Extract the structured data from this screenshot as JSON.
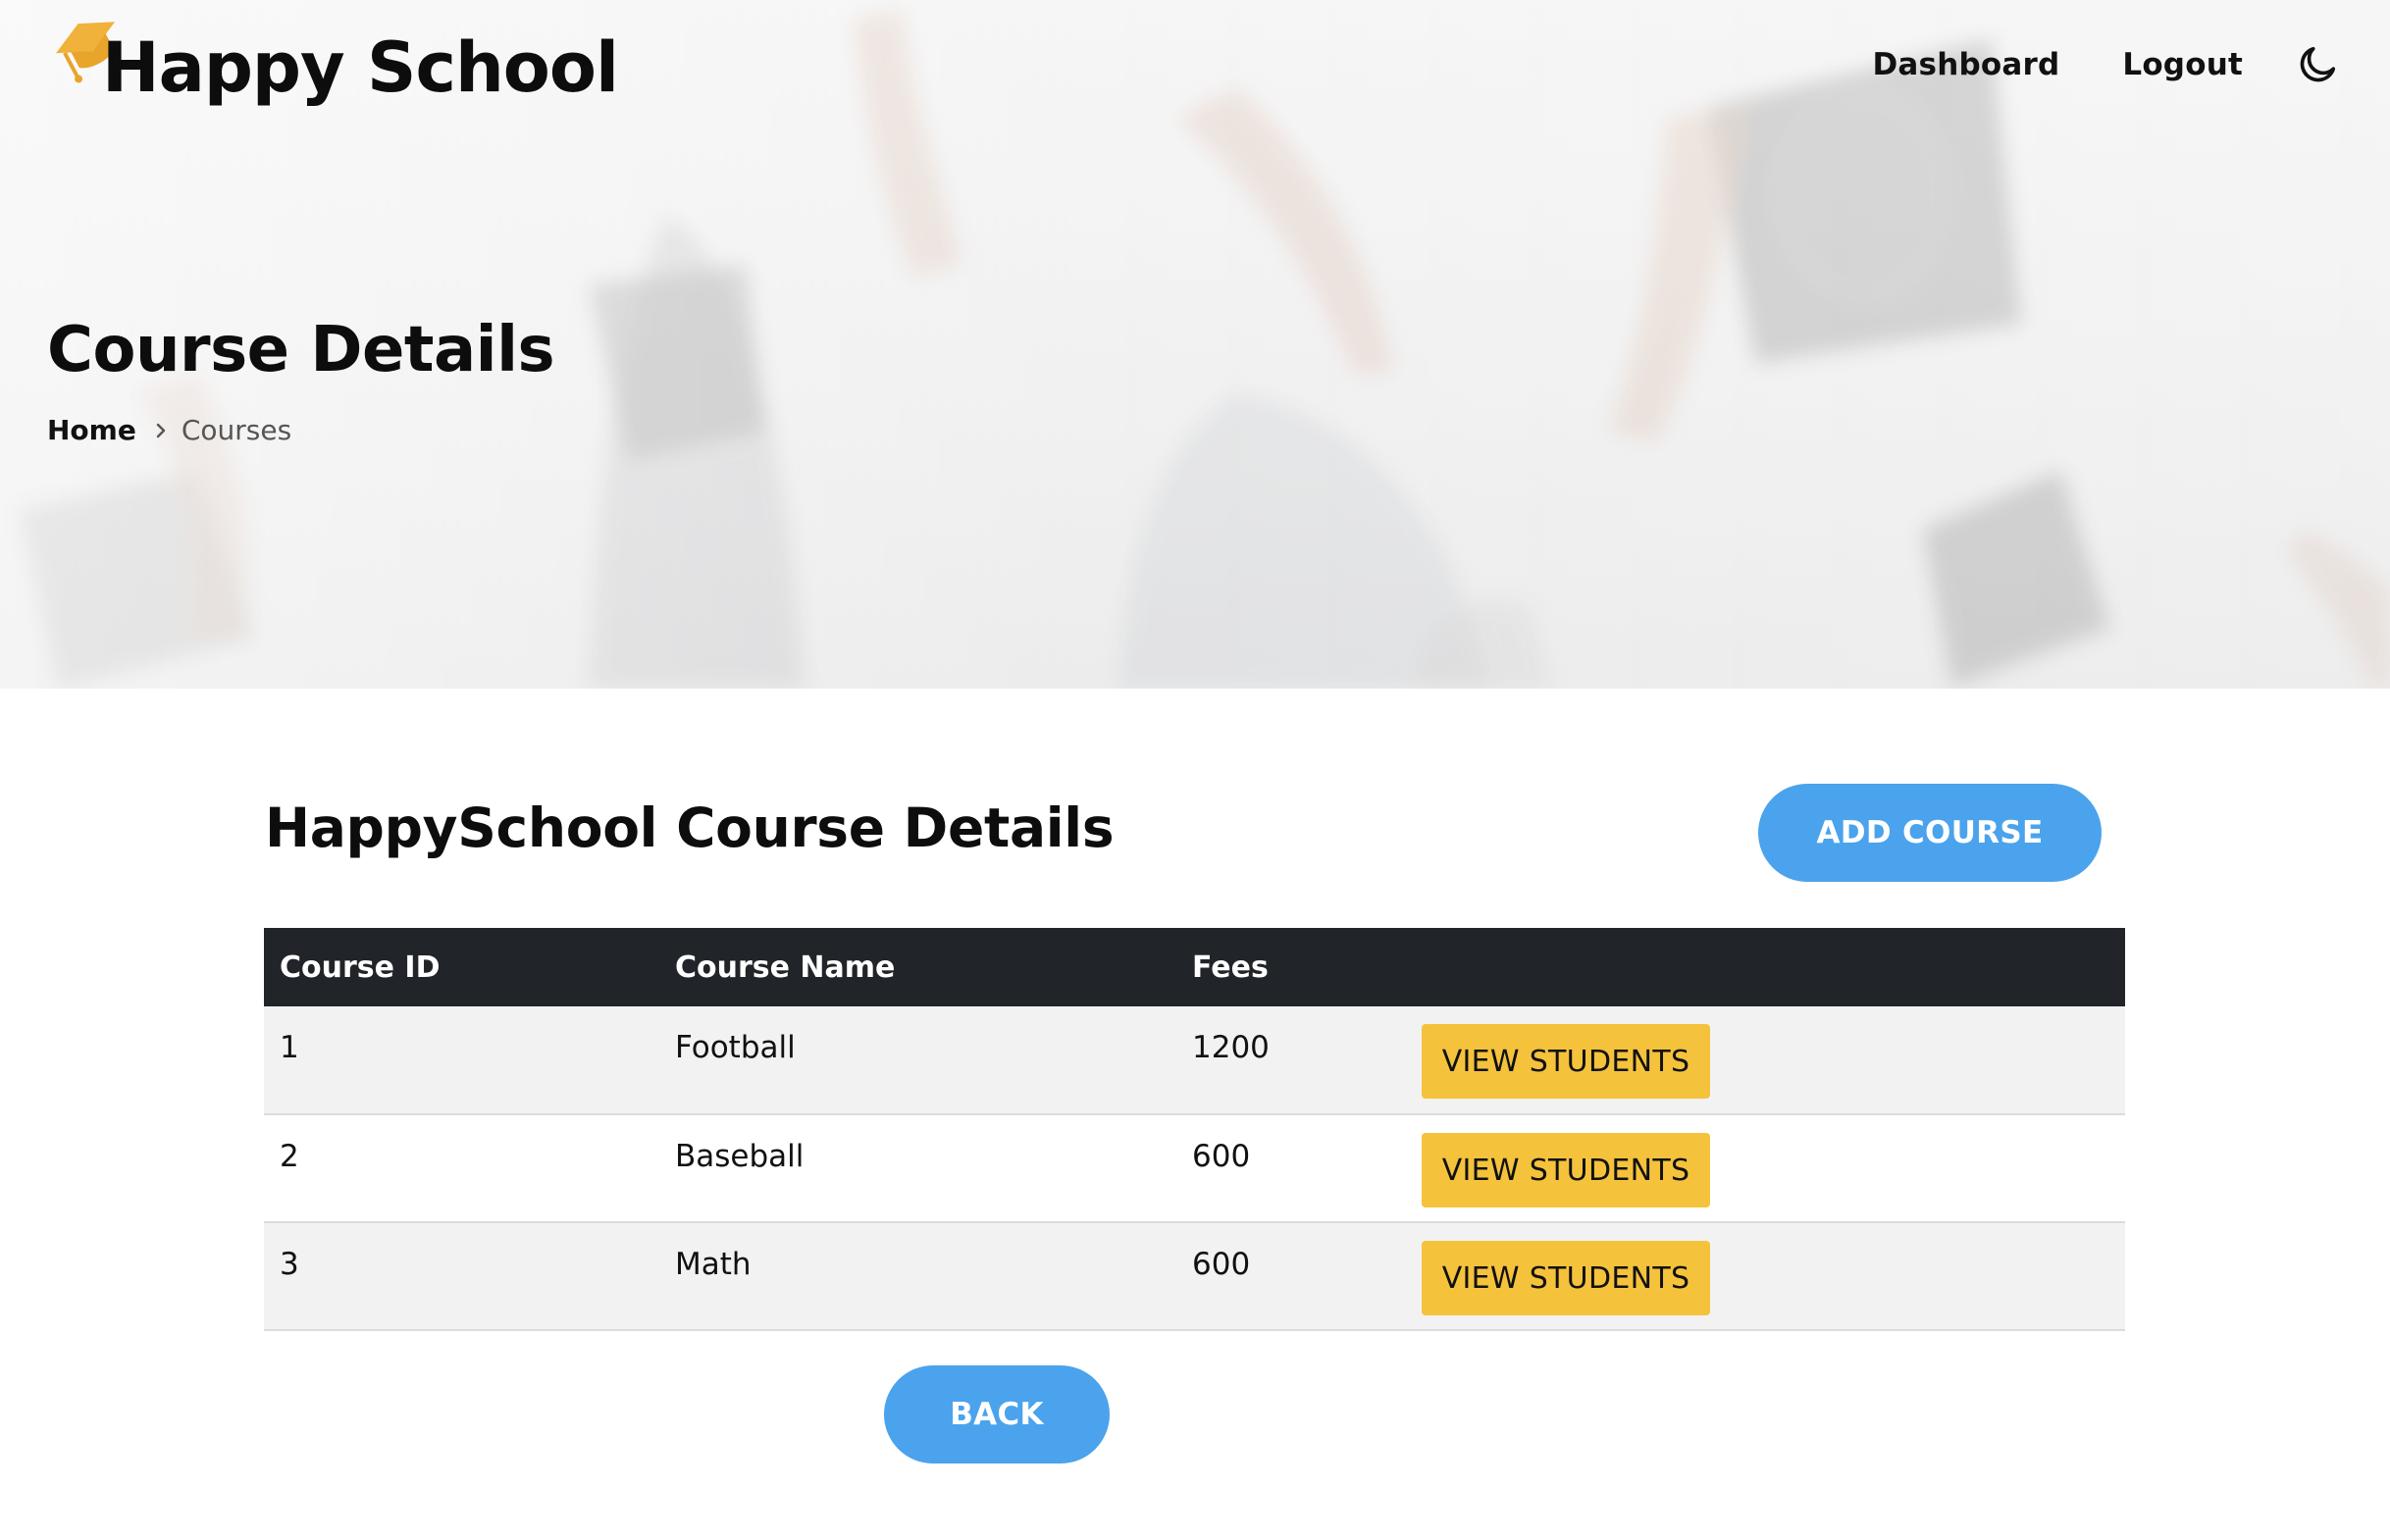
{
  "header": {
    "brand_name": "Happy School",
    "brand_icon": "graduation-cap-icon",
    "brand_color": "#f0b23a",
    "nav": [
      {
        "label": "Dashboard"
      },
      {
        "label": "Logout"
      }
    ],
    "theme_toggle_icon": "moon-icon"
  },
  "hero": {
    "title": "Course Details",
    "breadcrumb": {
      "home": "Home",
      "separator_icon": "chevron-right-icon",
      "current": "Courses"
    }
  },
  "main": {
    "section_title": "HappySchool Course Details",
    "add_button_label": "ADD COURSE",
    "back_button_label": "BACK",
    "accent_color": "#4aa3ec",
    "table": {
      "columns": [
        "Course ID",
        "Course Name",
        "Fees",
        ""
      ],
      "rows": [
        {
          "id": "1",
          "name": "Football",
          "fees": "1200",
          "action": "VIEW STUDENTS"
        },
        {
          "id": "2",
          "name": "Baseball",
          "fees": "600",
          "action": "VIEW STUDENTS"
        },
        {
          "id": "3",
          "name": "Math",
          "fees": "600",
          "action": "VIEW STUDENTS"
        }
      ],
      "header_color": "#212529",
      "action_color": "#f5c23c"
    }
  }
}
